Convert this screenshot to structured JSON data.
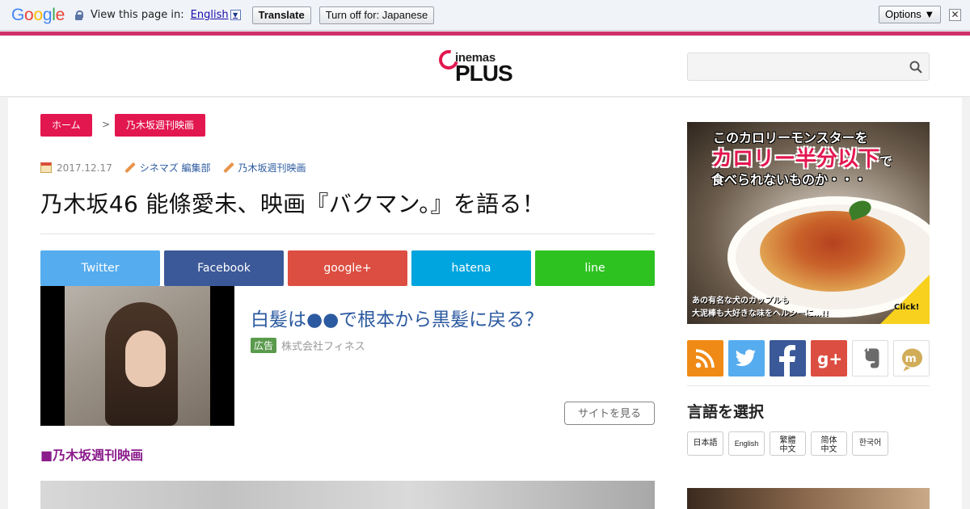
{
  "translate_bar": {
    "brand_letters": [
      {
        "ch": "G",
        "color": "#4285f4"
      },
      {
        "ch": "o",
        "color": "#ea4335"
      },
      {
        "ch": "o",
        "color": "#fbbc05"
      },
      {
        "ch": "g",
        "color": "#4285f4"
      },
      {
        "ch": "l",
        "color": "#34a853"
      },
      {
        "ch": "e",
        "color": "#ea4335"
      }
    ],
    "prompt": "View this page in:",
    "language": "English",
    "translate_label": "Translate",
    "turn_off_label": "Turn off for: Japanese",
    "options_label": "Options ▼",
    "close_label": "✕"
  },
  "header": {
    "logo_small": "inemas",
    "logo_big": "PLUS",
    "search_placeholder": ""
  },
  "breadcrumb": {
    "home": "ホーム",
    "separator": ">",
    "category": "乃木坂週刊映画"
  },
  "article": {
    "date": "2017.12.17",
    "author": "シネマズ 編集部",
    "category": "乃木坂週刊映画",
    "title": "乃木坂46 能條愛未、映画『バクマン。』を語る！",
    "section_label": "■乃木坂週刊映画"
  },
  "share_buttons": {
    "twitter": "Twitter",
    "facebook": "Facebook",
    "google": "google+",
    "hatena": "hatena",
    "line": "line"
  },
  "ad": {
    "title": "白髪は●●で根本から黒髪に戻る？",
    "badge": "広告",
    "sponsor": "株式会社フィネス",
    "cta": "サイトを見る"
  },
  "sidebar": {
    "banner": {
      "line1": "このカロリーモンスターを",
      "line2": "カロリー半分以下",
      "line2_suffix": "で",
      "line3": "食べられないものか・・・",
      "caption1": "あの有名な犬のカップルも",
      "caption2": "大泥棒も大好きな味をヘルシーに…!!",
      "click": "Click!"
    },
    "sns_icons": [
      "rss-icon",
      "twitter-icon",
      "facebook-icon",
      "google-plus-icon",
      "evernote-icon",
      "mixi-icon"
    ],
    "language_heading": "言語を選択",
    "languages": {
      "ja": "日本語",
      "en": "English",
      "zht_1": "繁體",
      "zht_2": "中文",
      "zhs_1": "简体",
      "zhs_2": "中文",
      "ko": "한국어"
    }
  },
  "colors": {
    "accent": "#e3174f",
    "link": "#2c5aa0",
    "section": "#8b1c8b"
  }
}
